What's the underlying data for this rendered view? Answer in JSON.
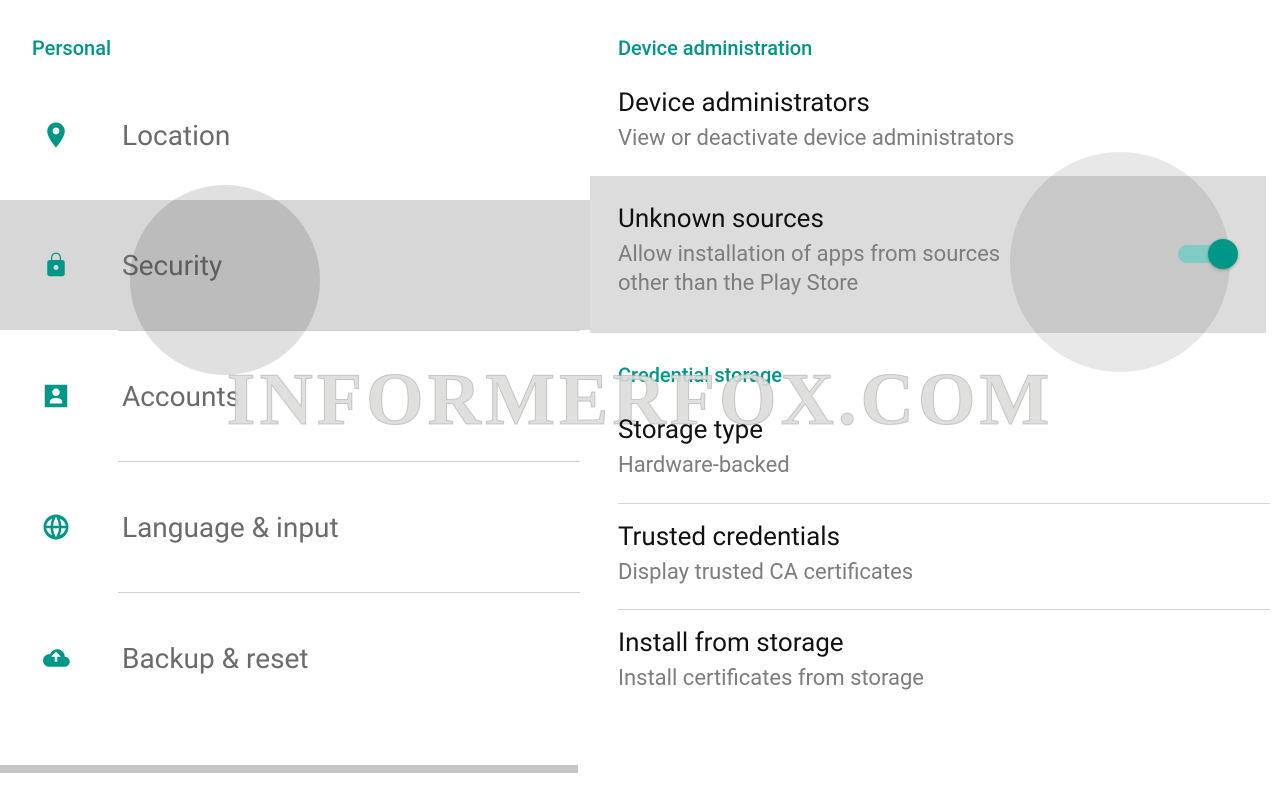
{
  "colors": {
    "accent": "#009688",
    "textPrimary": "#111",
    "textMuted": "#6b6b6b"
  },
  "left": {
    "header": "Personal",
    "items": [
      {
        "icon": "location-icon",
        "label": "Location",
        "selected": false
      },
      {
        "icon": "lock-icon",
        "label": "Security",
        "selected": true
      },
      {
        "icon": "account-icon",
        "label": "Accounts",
        "selected": false
      },
      {
        "icon": "globe-icon",
        "label": "Language & input",
        "selected": false
      },
      {
        "icon": "backup-icon",
        "label": "Backup & reset",
        "selected": false
      }
    ]
  },
  "right": {
    "sections": [
      {
        "header": "Device administration",
        "rows": [
          {
            "title": "Device administrators",
            "sub": "View or deactivate device administrators",
            "toggle": null,
            "highlight": false
          },
          {
            "title": "Unknown sources",
            "sub": "Allow installation of apps from sources other than the Play Store",
            "toggle": true,
            "highlight": true
          }
        ]
      },
      {
        "header": "Credential storage",
        "rows": [
          {
            "title": "Storage type",
            "sub": "Hardware-backed",
            "toggle": null,
            "highlight": false
          },
          {
            "title": "Trusted credentials",
            "sub": "Display trusted CA certificates",
            "toggle": null,
            "highlight": false
          },
          {
            "title": "Install from storage",
            "sub": "Install certificates from storage",
            "toggle": null,
            "highlight": false
          }
        ]
      }
    ]
  },
  "watermark": "INFORMERFOX.COM"
}
